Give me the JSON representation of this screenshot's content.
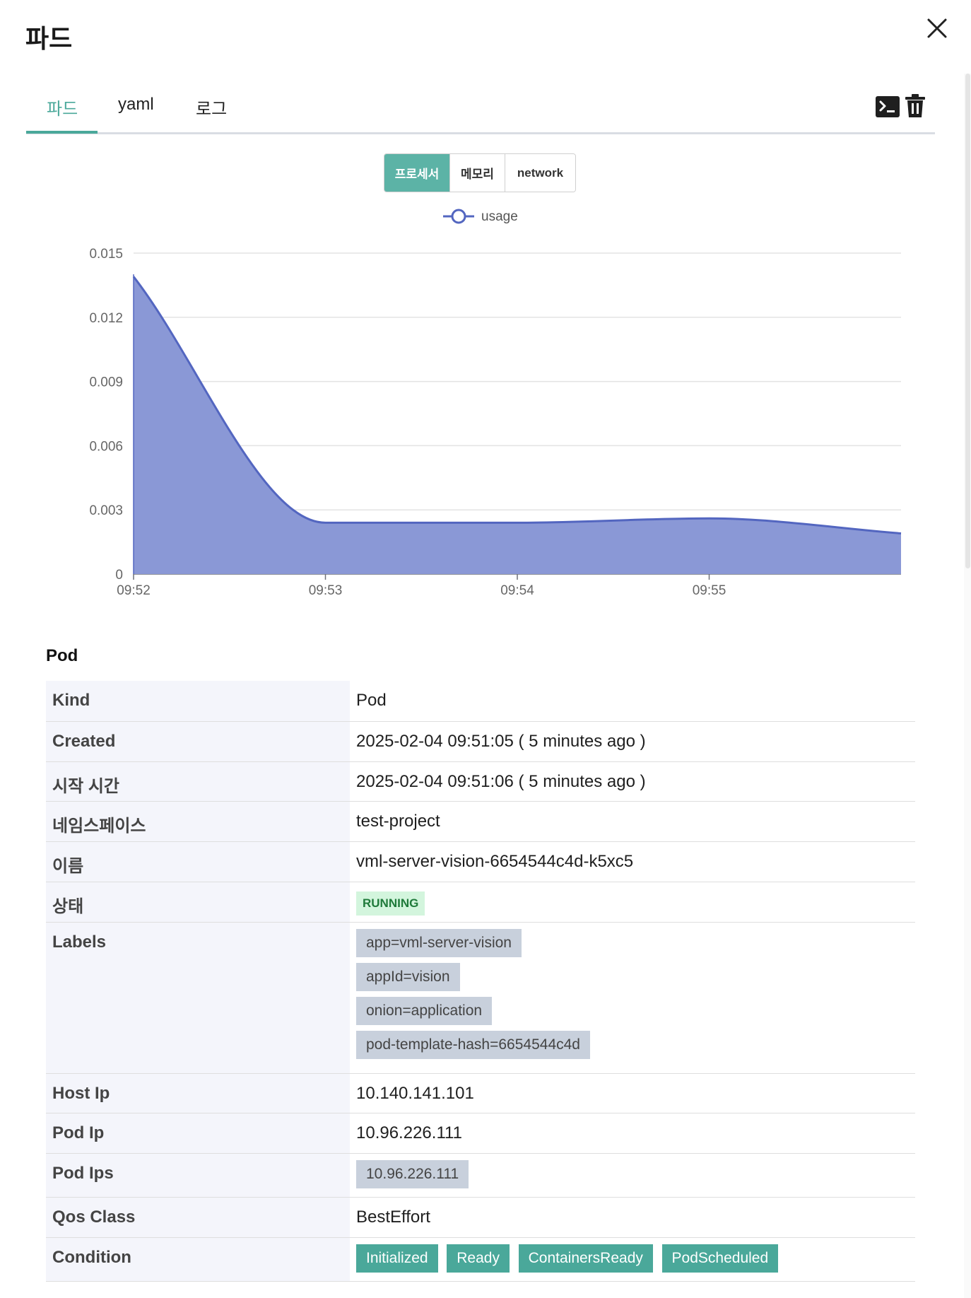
{
  "header": {
    "title": "파드"
  },
  "tabs": [
    {
      "label": "파드",
      "active": true
    },
    {
      "label": "yaml",
      "active": false
    },
    {
      "label": "로그",
      "active": false
    }
  ],
  "toolbar": {
    "terminal_icon": "terminal-icon",
    "delete_icon": "trash-icon"
  },
  "metric_tabs": [
    {
      "label": "프로세서",
      "active": true
    },
    {
      "label": "메모리",
      "active": false
    },
    {
      "label": "network",
      "active": false
    }
  ],
  "chart_data": {
    "type": "area",
    "legend": [
      "usage"
    ],
    "legend_position": "top-center",
    "grid": true,
    "ylim": [
      0,
      0.015
    ],
    "y_ticks": [
      "0",
      "0.003",
      "0.006",
      "0.009",
      "0.012",
      "0.015"
    ],
    "x_ticks": [
      "09:52",
      "09:53",
      "09:54",
      "09:55"
    ],
    "series": [
      {
        "name": "usage",
        "x": [
          "09:52:00",
          "09:53:00",
          "09:54:00",
          "09:55:00",
          "09:56:00"
        ],
        "values": [
          0.0139,
          0.0024,
          0.0024,
          0.0026,
          0.0019
        ]
      }
    ],
    "colors": {
      "line": "#5366c0",
      "fill": "#8a98d6"
    }
  },
  "section": {
    "title": "Pod"
  },
  "properties": {
    "kind_label": "Kind",
    "kind": "Pod",
    "created_label": "Created",
    "created": "2025-02-04 09:51:05 ( 5 minutes ago )",
    "start_label": "시작 시간",
    "start": "2025-02-04 09:51:06 ( 5 minutes ago )",
    "namespace_label": "네임스페이스",
    "namespace": "test-project",
    "name_label": "이름",
    "name": "vml-server-vision-6654544c4d-k5xc5",
    "status_label": "상태",
    "status": "RUNNING",
    "labels_label": "Labels",
    "labels": [
      "app=vml-server-vision",
      "appId=vision",
      "onion=application",
      "pod-template-hash=6654544c4d"
    ],
    "host_ip_label": "Host Ip",
    "host_ip": "10.140.141.101",
    "pod_ip_label": "Pod Ip",
    "pod_ip": "10.96.226.111",
    "pod_ips_label": "Pod Ips",
    "pod_ips": [
      "10.96.226.111"
    ],
    "qos_label": "Qos Class",
    "qos": "BestEffort",
    "condition_label": "Condition",
    "conditions": [
      "Initialized",
      "Ready",
      "ContainersReady",
      "PodScheduled"
    ]
  }
}
